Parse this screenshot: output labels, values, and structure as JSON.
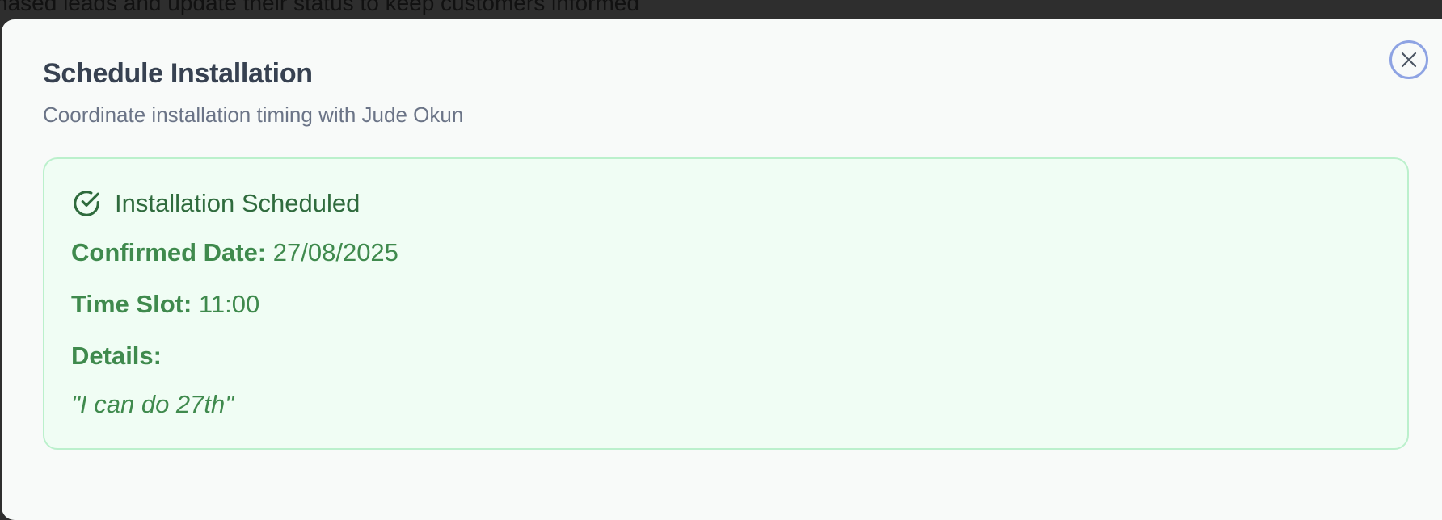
{
  "background": {
    "partial_text": "hased leads and update their status to keep customers informed"
  },
  "dialog": {
    "title": "Schedule Installation",
    "subtitle": "Coordinate installation timing with Jude Okun",
    "close_icon": "close-icon",
    "status": {
      "icon": "check-circle-icon",
      "title": "Installation Scheduled"
    },
    "confirmed_date": {
      "label": "Confirmed Date:",
      "value": "27/08/2025"
    },
    "time_slot": {
      "label": "Time Slot:",
      "value": "11:00"
    },
    "details": {
      "label": "Details:",
      "value": "\"I can do 27th\""
    }
  },
  "colors": {
    "card_background": "#f0fdf4",
    "card_border": "#bbf0cc",
    "success_text": "#3f8a4d",
    "success_title": "#2f6b3d",
    "close_ring": "#8ea3e3"
  }
}
